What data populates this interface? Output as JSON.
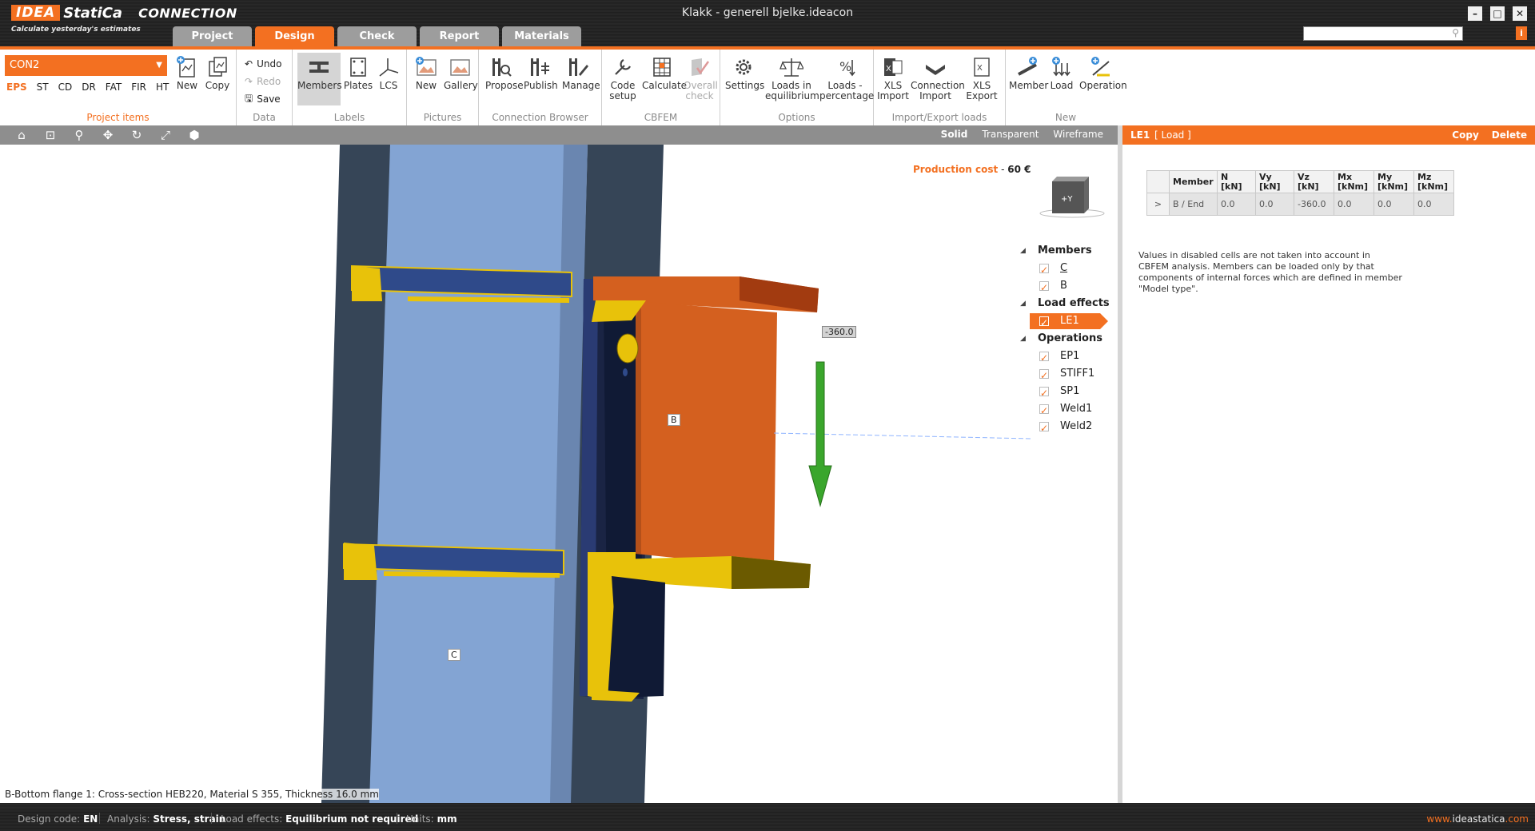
{
  "app": {
    "logo_idea": "IDEA",
    "logo_statica": "StatiCa",
    "logo_product": "CONNECTION",
    "tagline": "Calculate yesterday's estimates",
    "doc_title": "Klakk - generell bjelke.ideacon",
    "window_controls": [
      "minimize-icon",
      "maximize-icon",
      "close-icon"
    ]
  },
  "tabs": [
    {
      "label": "Project",
      "active": false
    },
    {
      "label": "Design",
      "active": true
    },
    {
      "label": "Check",
      "active": false
    },
    {
      "label": "Report",
      "active": false
    },
    {
      "label": "Materials",
      "active": false
    }
  ],
  "ribbon": {
    "project_items": {
      "label": "Project items",
      "connection": "CON2",
      "standards": [
        "EPS",
        "ST",
        "CD",
        "DR",
        "FAT",
        "FIR",
        "HT"
      ],
      "active_standard": "EPS",
      "new": "New",
      "copy": "Copy"
    },
    "data": {
      "label": "Data",
      "undo": "Undo",
      "redo": "Redo",
      "save": "Save"
    },
    "labels": {
      "label": "Labels",
      "members": "Members",
      "plates": "Plates",
      "lcs": "LCS"
    },
    "pictures": {
      "label": "Pictures",
      "new": "New",
      "gallery": "Gallery"
    },
    "connection_browser": {
      "label": "Connection Browser",
      "propose": "Propose",
      "publish": "Publish",
      "manage": "Manage"
    },
    "cbfem": {
      "label": "CBFEM",
      "code_setup_1": "Code",
      "code_setup_2": "setup",
      "calculate": "Calculate",
      "overall_1": "Overall",
      "overall_2": "check"
    },
    "options": {
      "label": "Options",
      "settings": "Settings",
      "loads_eq_1": "Loads in",
      "loads_eq_2": "equilibrium",
      "loads_pct_1": "Loads -",
      "loads_pct_2": "percentage"
    },
    "import_export": {
      "label": "Import/Export loads",
      "xls_import_1": "XLS",
      "xls_import_2": "Import",
      "conn_import_1": "Connection",
      "conn_import_2": "Import",
      "xls_export_1": "XLS",
      "xls_export_2": "Export"
    },
    "new_group": {
      "label": "New",
      "member": "Member",
      "load": "Load",
      "operation": "Operation"
    }
  },
  "viewbar": {
    "icons": [
      "home-icon",
      "zoom-window-icon",
      "zoom-icon",
      "pan-icon",
      "rotate-icon",
      "fit-icon",
      "eraser-icon"
    ],
    "modes": [
      "Solid",
      "Transparent",
      "Wireframe"
    ],
    "active_mode": "Solid"
  },
  "viewport": {
    "production_cost_label": "Production cost",
    "production_cost_sep": "-",
    "production_cost_value": "60 €",
    "navcube_label": "+Y",
    "label_b": "B",
    "label_c": "C",
    "force_label": "-360.0",
    "status_text": "B-Bottom flange 1: Cross-section HEB220, Material S 355, Thickness 16.0 mm",
    "tree": [
      {
        "type": "header",
        "label": "Members"
      },
      {
        "type": "item",
        "label": "C",
        "underline": true
      },
      {
        "type": "item",
        "label": "B"
      },
      {
        "type": "header",
        "label": "Load effects"
      },
      {
        "type": "item",
        "label": "LE1",
        "active": true
      },
      {
        "type": "header",
        "label": "Operations"
      },
      {
        "type": "item",
        "label": "EP1"
      },
      {
        "type": "item",
        "label": "STIFF1"
      },
      {
        "type": "item",
        "label": "SP1"
      },
      {
        "type": "item",
        "label": "Weld1"
      },
      {
        "type": "item",
        "label": "Weld2"
      }
    ]
  },
  "right_panel": {
    "title": "LE1",
    "subtitle": "[ Load ]",
    "copy": "Copy",
    "delete": "Delete",
    "table": {
      "headers": [
        {
          "l1": "Member",
          "l2": ""
        },
        {
          "l1": "N",
          "l2": "[kN]"
        },
        {
          "l1": "Vy",
          "l2": "[kN]"
        },
        {
          "l1": "Vz",
          "l2": "[kN]"
        },
        {
          "l1": "Mx",
          "l2": "[kNm]"
        },
        {
          "l1": "My",
          "l2": "[kNm]"
        },
        {
          "l1": "Mz",
          "l2": "[kNm]"
        }
      ],
      "rows": [
        {
          "expander": ">",
          "cells": [
            "B / End",
            "0.0",
            "0.0",
            "-360.0",
            "0.0",
            "0.0",
            "0.0"
          ]
        }
      ]
    },
    "note": "Values in disabled cells are not taken into account in CBFEM analysis. Members can be loaded only by that components of internal forces which are defined in member \"Model type\"."
  },
  "statusbar": {
    "design_code_label": "Design code:",
    "design_code": "EN",
    "analysis_label": "Analysis:",
    "analysis": "Stress, strain",
    "load_effects_label": "Load effects:",
    "load_effects": "Equilibrium not required",
    "units_label": "Units:",
    "units": "mm",
    "website_prefix": "www.",
    "website_main": "ideastatica",
    "website_suffix": ".com"
  },
  "colors": {
    "accent": "#f37021",
    "column": "#83a4d3",
    "column_dark": "#364557",
    "beam": "#d4601f",
    "plate": "#e8c20a",
    "force_arrow": "#3aa62c"
  }
}
